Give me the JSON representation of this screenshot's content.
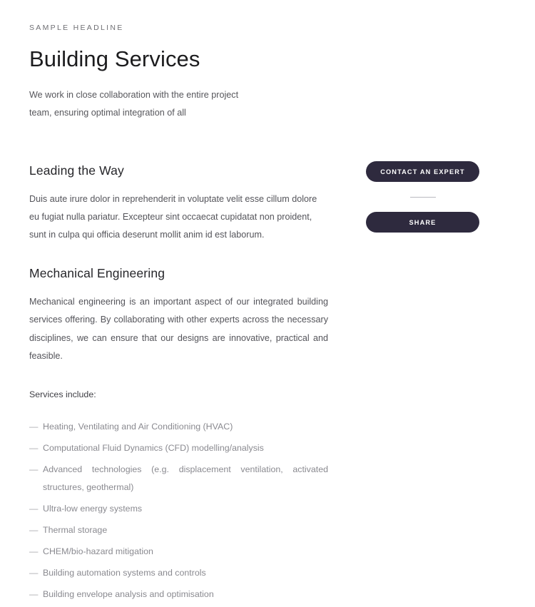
{
  "article": {
    "eyebrow": "SAMPLE HEADLINE",
    "title": "Building Services",
    "intro": "We work in close collaboration with the entire project team, ensuring optimal integration of all",
    "sections": [
      {
        "heading": "Leading the Way",
        "body": "Duis aute irure dolor in reprehenderit in voluptate velit esse cillum dolore eu fugiat nulla pariatur. Excepteur sint occaecat cupidatat non proident, sunt in culpa qui officia deserunt mollit anim id est laborum."
      },
      {
        "heading": "Mechanical Engineering",
        "body": "Mechanical engineering is an important aspect of our integrated building services offering. By collaborating with other experts across the necessary disciplines, we can ensure that our designs are innovative, practical and feasible."
      }
    ],
    "services_label": "Services include:",
    "services": [
      "Heating, Ventilating and Air Conditioning (HVAC)",
      "Computational Fluid Dynamics (CFD) modelling/analysis",
      "Advanced technologies (e.g. displacement ventilation, activated structures, geothermal)",
      "Ultra-low energy systems",
      "Thermal storage",
      "CHEM/bio-hazard mitigation",
      "Building automation systems and controls",
      "Building envelope analysis and optimisation"
    ],
    "list_marker": "—"
  },
  "sidebar": {
    "contact_button": "CONTACT AN EXPERT",
    "share_button": "SHARE"
  },
  "colors": {
    "button_background": "#2e2a3e",
    "button_text": "#ffffff",
    "page_background": "#ffffff",
    "title_text": "#1c1c1e",
    "body_text": "#54545a",
    "muted_text": "#8a8a90",
    "divider": "#b9b9bf"
  }
}
